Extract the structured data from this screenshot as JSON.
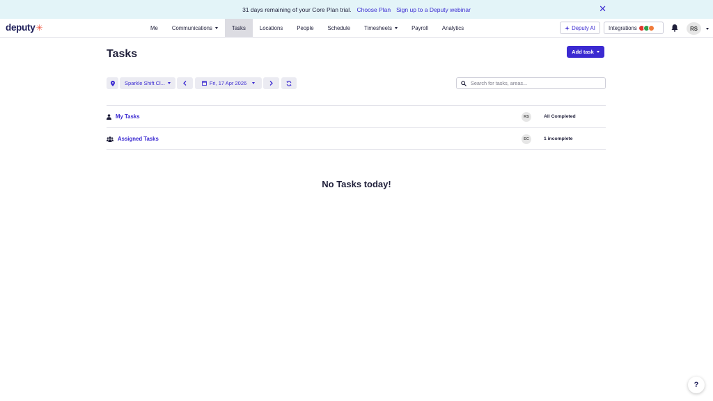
{
  "banner": {
    "message": "31 days remaining of your Core Plan trial.",
    "choose_plan": "Choose Plan",
    "webinar": "Sign up to a Deputy webinar",
    "close_glyph": "✕"
  },
  "nav": {
    "logo": "deputy",
    "logo_mark": "✳",
    "items": [
      {
        "label": "Me"
      },
      {
        "label": "Communications"
      },
      {
        "label": "Tasks"
      },
      {
        "label": "Locations"
      },
      {
        "label": "People"
      },
      {
        "label": "Schedule"
      },
      {
        "label": "Timesheets"
      },
      {
        "label": "Payroll"
      },
      {
        "label": "Analytics"
      }
    ],
    "active": "Tasks",
    "ai_button": "Deputy AI",
    "integrations": "Integrations",
    "user_initials": "RS"
  },
  "page": {
    "title": "Tasks",
    "add_task": "Add task",
    "location": "Sparkle Shift Cl...",
    "date": "Fri, 17 Apr 2026",
    "search_placeholder": "Search for tasks, areas..."
  },
  "task_groups": [
    {
      "label": "My Tasks",
      "icon": "user-icon",
      "assignee": "RS",
      "status": "All Completed"
    },
    {
      "label": "Assigned Tasks",
      "icon": "users-icon",
      "assignee": "EC",
      "status": "1 incomplete"
    }
  ],
  "empty_state": "No Tasks today!",
  "help_glyph": "?",
  "colors": {
    "accent": "#3b2ad1",
    "banner_bg": "#e3f4f8",
    "active_tab_bg": "#dcdce2",
    "logo_star": "#f0533d"
  }
}
